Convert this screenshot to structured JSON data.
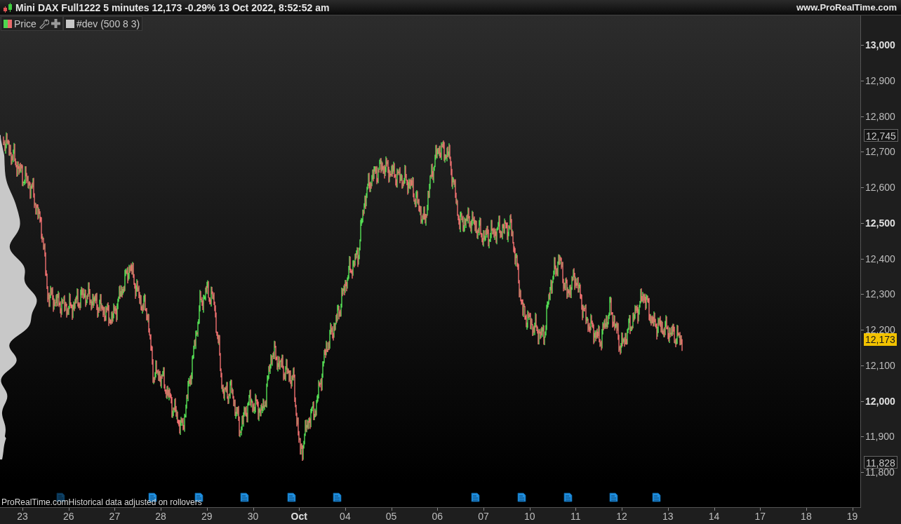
{
  "title_bar": {
    "title": "Mini DAX Full1222 5 minutes 12,173 -0.29% 13 Oct 2022, 8:52:52 am",
    "website": "www.ProRealTime.com"
  },
  "legend": [
    {
      "kind": "price",
      "label": "Price"
    },
    {
      "kind": "indicator",
      "label": "#dev (500 8 3)"
    }
  ],
  "price_axis": {
    "ticks": [
      {
        "label": "13,000",
        "major": true
      },
      {
        "label": "12,900",
        "major": false
      },
      {
        "label": "12,800",
        "major": false
      },
      {
        "label": "12,700",
        "major": false
      },
      {
        "label": "12,600",
        "major": false
      },
      {
        "label": "12,500",
        "major": true
      },
      {
        "label": "12,400",
        "major": false
      },
      {
        "label": "12,300",
        "major": false
      },
      {
        "label": "12,200",
        "major": false
      },
      {
        "label": "12,100",
        "major": false
      },
      {
        "label": "12,000",
        "major": true
      },
      {
        "label": "11,900",
        "major": false
      },
      {
        "label": "11,800",
        "major": false
      }
    ],
    "markers": [
      {
        "label": "12,745",
        "kind": "high"
      },
      {
        "label": "12,173",
        "kind": "last"
      },
      {
        "label": "11,828",
        "kind": "low"
      }
    ]
  },
  "time_axis": {
    "ticks": [
      {
        "label": "23",
        "major": false
      },
      {
        "label": "26",
        "major": false
      },
      {
        "label": "27",
        "major": false
      },
      {
        "label": "28",
        "major": false
      },
      {
        "label": "29",
        "major": false
      },
      {
        "label": "30",
        "major": false
      },
      {
        "label": "Oct",
        "major": true
      },
      {
        "label": "04",
        "major": false
      },
      {
        "label": "05",
        "major": false
      },
      {
        "label": "06",
        "major": false
      },
      {
        "label": "07",
        "major": false
      },
      {
        "label": "10",
        "major": false
      },
      {
        "label": "11",
        "major": false
      },
      {
        "label": "12",
        "major": false
      },
      {
        "label": "13",
        "major": false
      },
      {
        "label": "14",
        "major": false
      },
      {
        "label": "17",
        "major": false
      },
      {
        "label": "18",
        "major": false
      },
      {
        "label": "19",
        "major": false
      }
    ]
  },
  "footer_note": "ProRealTime.comHistorical data adjusted on rollovers"
}
